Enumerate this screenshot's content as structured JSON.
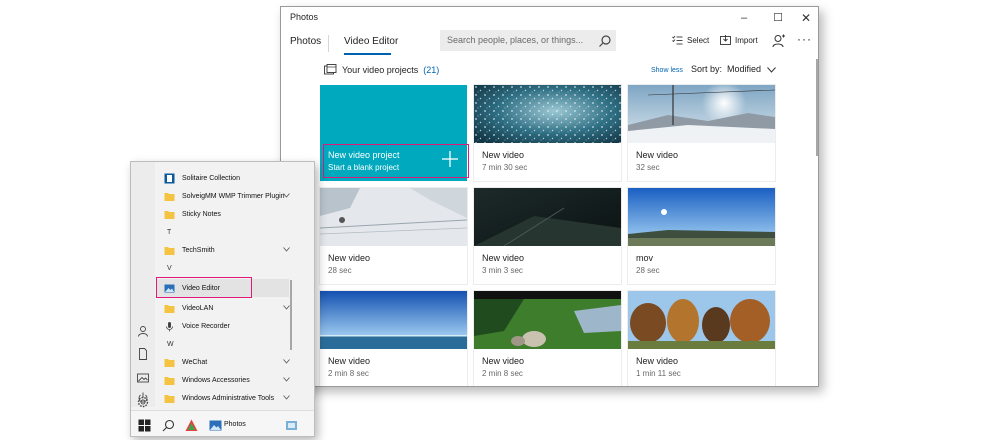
{
  "window": {
    "title": "Photos",
    "controls": {
      "minimize": "–",
      "maximize": "☐",
      "close": "✕"
    }
  },
  "nav": {
    "tabs": [
      {
        "label": "Photos"
      },
      {
        "label": "Video Editor",
        "active": true
      }
    ],
    "search_placeholder": "Search people, places, or things...",
    "select_label": "Select",
    "import_label": "Import",
    "more_label": "···"
  },
  "projects": {
    "header": "Your video projects",
    "count": "(21)",
    "show_less": "Show less",
    "sort_by_label": "Sort by:",
    "sort_value": "Modified",
    "new_project": {
      "title": "New video project",
      "subtitle": "Start a blank project"
    },
    "items": [
      {
        "name": "New video",
        "duration": "7 min 30 sec"
      },
      {
        "name": "New video",
        "duration": "32 sec"
      },
      {
        "name": "New video",
        "duration": "28 sec"
      },
      {
        "name": "New video",
        "duration": "3 min 3 sec"
      },
      {
        "name": "mov",
        "duration": "28 sec"
      },
      {
        "name": "New video",
        "duration": "2 min 8 sec"
      },
      {
        "name": "New video",
        "duration": "2 min 8 sec"
      },
      {
        "name": "New video",
        "duration": "1 min 11 sec"
      }
    ]
  },
  "start_menu": {
    "apps": [
      {
        "label": "Solitaire Collection",
        "icon": "solitaire-icon"
      },
      {
        "label": "SolveigMM WMP Trimmer Plugin",
        "icon": "folder-icon",
        "expandable": true
      },
      {
        "label": "Sticky Notes",
        "icon": "folder-icon"
      },
      {
        "label": "T",
        "type": "letter"
      },
      {
        "label": "TechSmith",
        "icon": "folder-icon",
        "expandable": true
      },
      {
        "label": "V",
        "type": "letter"
      },
      {
        "label": "Video Editor",
        "icon": "video-editor-icon"
      },
      {
        "label": "VideoLAN",
        "icon": "folder-icon",
        "expandable": true
      },
      {
        "label": "Voice Recorder",
        "icon": "microphone-icon"
      },
      {
        "label": "W",
        "type": "letter"
      },
      {
        "label": "WeChat",
        "icon": "folder-icon",
        "expandable": true
      },
      {
        "label": "Windows Accessories",
        "icon": "folder-icon",
        "expandable": true
      },
      {
        "label": "Windows Administrative Tools",
        "icon": "folder-icon",
        "expandable": true
      }
    ],
    "taskbar": {
      "photos_label": "Photos"
    }
  },
  "colors": {
    "accent": "#0063b1",
    "new_project_tile": "#00a9bd",
    "highlight": "#e0197a",
    "folder": "#f5c342"
  }
}
